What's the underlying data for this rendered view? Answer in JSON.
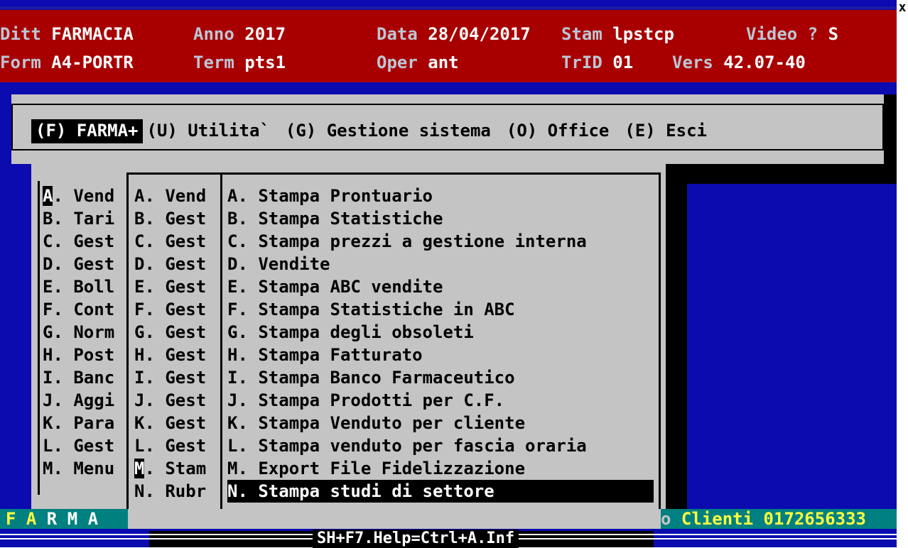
{
  "window": {
    "close_glyph": "x"
  },
  "header": {
    "ditt_label": "Ditt",
    "ditt_value": "FARMACIA",
    "anno_label": "Anno",
    "anno_value": "2017",
    "data_label": "Data",
    "data_value": "28/04/2017",
    "stam_label": "Stam",
    "stam_value": "lpstcp",
    "video_label": "Video ?",
    "video_value": "S",
    "form_label": "Form",
    "form_value": "A4-PORTR",
    "term_label": "Term",
    "term_value": "pts1",
    "oper_label": "Oper",
    "oper_value": "ant",
    "trid_label": "TrID",
    "trid_value": "01",
    "vers_label": "Vers",
    "vers_value": "42.07-40"
  },
  "menubar": {
    "items": [
      {
        "label": "(F) FARMA+",
        "selected": true
      },
      {
        "label": "(U) Utilita`",
        "selected": false
      },
      {
        "label": "(G) Gestione sistema",
        "selected": false
      },
      {
        "label": "(O) Office",
        "selected": false
      },
      {
        "label": "(E) Esci",
        "selected": false
      }
    ]
  },
  "menu1": {
    "items": [
      "A. Vend",
      "B. Tari",
      "C. Gest",
      "D. Gest",
      "E. Boll",
      "F. Cont",
      "G. Norm",
      "H. Post",
      "I. Banc",
      "J. Aggi",
      "K. Para",
      "L. Gest",
      "M. Menu"
    ]
  },
  "menu2": {
    "items": [
      "A. Vend",
      "B. Gest",
      "C. Gest",
      "D. Gest",
      "E. Gest",
      "F. Gest",
      "G. Gest",
      "H. Gest",
      "I. Gest",
      "J. Gest",
      "K. Gest",
      "L. Gest",
      "M. Stam",
      "N. Rubr"
    ]
  },
  "menu3": {
    "items": [
      "A. Stampa Prontuario",
      "B. Stampa Statistiche",
      "C. Stampa prezzi a gestione interna",
      "D. Vendite",
      "E. Stampa ABC vendite",
      "F. Stampa Statistiche in ABC",
      "G. Stampa degli obsoleti",
      "H. Stampa Fatturato",
      "I. Stampa Banco Farmaceutico",
      "J. Stampa Prodotti per C.F.",
      "K. Stampa Venduto per cliente",
      "L. Stampa venduto per fascia oraria",
      "M. Export File Fidelizzazione",
      "N. Stampa studi di settore"
    ]
  },
  "status": {
    "farma_letters": "F A",
    "farma_rest": " R M A",
    "clienti_prefix": "o",
    "clienti": "Clienti 0172656333"
  },
  "help": {
    "text": "SH+F7.Help=Ctrl+A.Inf"
  },
  "colors": {
    "header_bg": "#a80000",
    "screen_bg": "#0b0bb0",
    "panel_bg": "#c4c4c4",
    "status_bg": "#008080"
  }
}
